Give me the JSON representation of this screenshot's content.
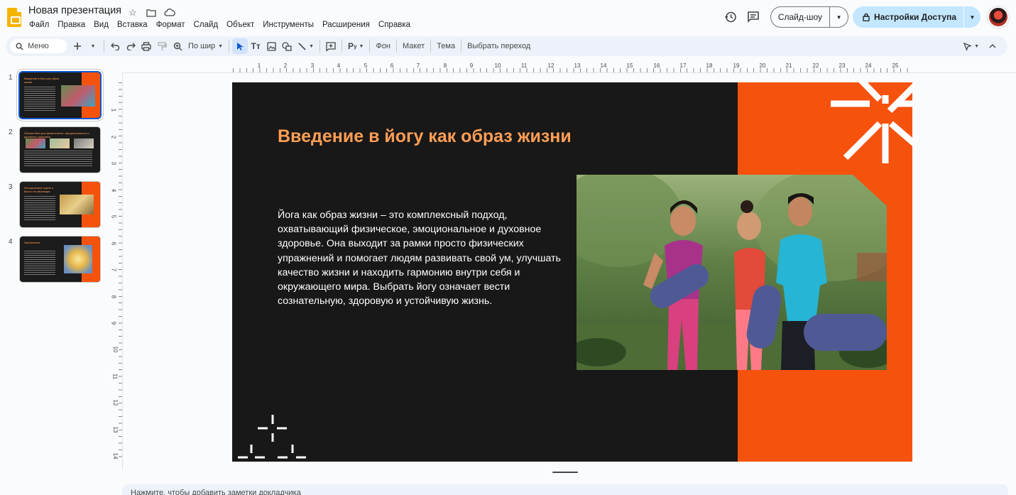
{
  "header": {
    "doc_title": "Новая презентация",
    "menu": [
      "Файл",
      "Правка",
      "Вид",
      "Вставка",
      "Формат",
      "Слайд",
      "Объект",
      "Инструменты",
      "Расширения",
      "Справка"
    ],
    "slideshow_label": "Слайд-шоу",
    "share_label": "Настройки Доступа"
  },
  "toolbar": {
    "search_placeholder": "Меню",
    "zoom_label": "По шир",
    "background_label": "Фон",
    "layout_label": "Макет",
    "theme_label": "Тема",
    "transition_label": "Выбрать переход"
  },
  "filmstrip": {
    "slides": [
      {
        "number": "1",
        "title": "Введение в йогу как образ жизни"
      },
      {
        "number": "2",
        "title": "Польза йоги для физического, эмоционального и духовного здоровья"
      },
      {
        "number": "3",
        "title": "Исторические корни и йоги и ее эволюция"
      },
      {
        "number": "4",
        "title": "Заключение"
      }
    ]
  },
  "rulers": {
    "top": [
      "1",
      "2",
      "3",
      "4",
      "5",
      "6",
      "7",
      "8",
      "9",
      "10",
      "11",
      "12",
      "13",
      "14",
      "15",
      "16",
      "17",
      "18",
      "19",
      "20",
      "21",
      "22",
      "23",
      "24",
      "25"
    ],
    "left": [
      "1",
      "2",
      "3",
      "4",
      "5",
      "6",
      "7",
      "8",
      "9",
      "10",
      "11",
      "12",
      "13",
      "14"
    ]
  },
  "slide": {
    "title": "Введение в йогу как образ жизни",
    "body": "Йога как образ жизни – это комплексный подход, охватывающий физическое, эмоциональное и духовное здоровье. Она выходит за рамки просто физических упражнений и помогает людям развивать свой ум, улучшать качество жизни и находить гармонию внутри себя и окружающего мира. Выбрать йогу означает вести сознательную, здоровую и устойчивую жизнь."
  },
  "notes": {
    "placeholder": "Нажмите, чтобы добавить заметки докладчика"
  },
  "colors": {
    "slide_bg": "#181818",
    "accent_orange": "#f5520d",
    "title_orange": "#ff9e55",
    "share_button": "#c2e7ff"
  }
}
